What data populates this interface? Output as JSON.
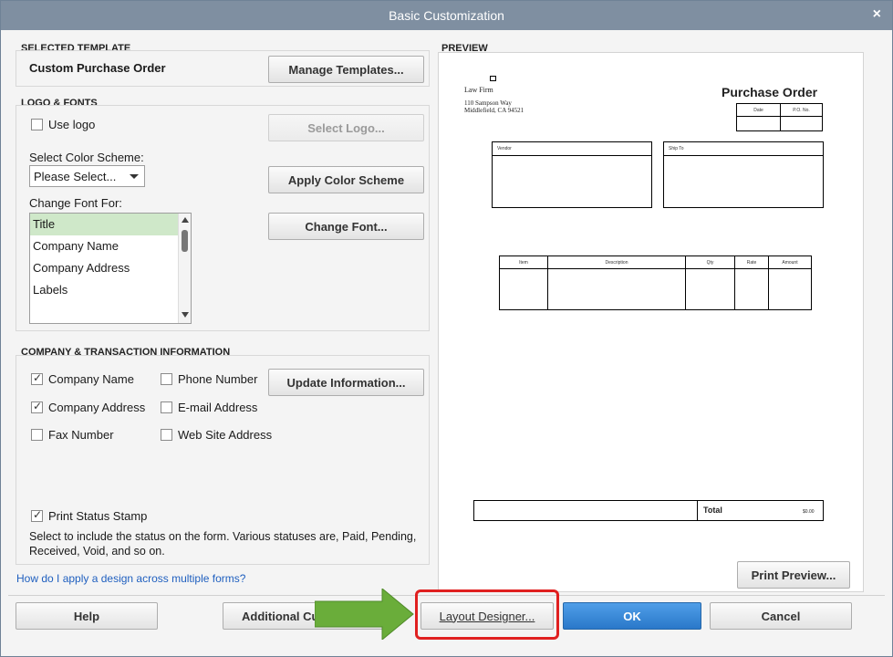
{
  "window": {
    "title": "Basic Customization",
    "close_glyph": "×"
  },
  "selected_template": {
    "section_title": "SELECTED TEMPLATE",
    "template_name": "Custom Purchase Order",
    "manage_button": "Manage Templates..."
  },
  "logo_fonts": {
    "section_title": "LOGO & FONTS",
    "use_logo_label": "Use logo",
    "use_logo_checked": false,
    "select_logo_button": "Select Logo...",
    "color_scheme_label": "Select Color Scheme:",
    "color_scheme_value": "Please Select...",
    "apply_color_button": "Apply Color Scheme",
    "change_font_for_label": "Change Font For:",
    "change_font_button": "Change Font...",
    "font_items": [
      {
        "label": "Title",
        "selected": true
      },
      {
        "label": "Company Name",
        "selected": false
      },
      {
        "label": "Company Address",
        "selected": false
      },
      {
        "label": "Labels",
        "selected": false
      }
    ]
  },
  "company_info": {
    "section_title": "COMPANY & TRANSACTION INFORMATION",
    "company_name": {
      "label": "Company Name",
      "checked": true
    },
    "company_address": {
      "label": "Company Address",
      "checked": true
    },
    "fax_number": {
      "label": "Fax Number",
      "checked": false
    },
    "phone_number": {
      "label": "Phone Number",
      "checked": false
    },
    "email_address": {
      "label": "E-mail Address",
      "checked": false
    },
    "web_site": {
      "label": "Web Site Address",
      "checked": false
    },
    "update_button": "Update Information...",
    "print_status": {
      "label": "Print Status Stamp",
      "checked": true
    },
    "status_description": "Select to include the status on the form. Various statuses are, Paid, Pending, Received, Void, and so on."
  },
  "help_link": "How do I apply a design across multiple forms?",
  "preview": {
    "section_title": "PREVIEW",
    "company_name": "Law Firm",
    "address_line1": "110 Sampson Way",
    "address_line2": "Middlefield, CA  94521",
    "form_title": "Purchase Order",
    "date_label": "Date",
    "po_label": "P.O. No.",
    "vendor_label": "Vendor",
    "ship_to_label": "Ship To",
    "columns": [
      "Item",
      "Description",
      "Qty",
      "Rate",
      "Amount"
    ],
    "total_label": "Total",
    "total_value": "$0.00",
    "print_preview_button": "Print Preview..."
  },
  "footer": {
    "help_button": "Help",
    "additional_button": "Additional Cu",
    "layout_designer_button": "Layout Designer...",
    "ok_button": "OK",
    "cancel_button": "Cancel"
  },
  "colors": {
    "titlebar": "#7f8fa1",
    "ok_button": "#2a78c9",
    "selected_item": "#cfe8c9",
    "highlight": "#e02020",
    "arrow": "#6aad3a"
  }
}
